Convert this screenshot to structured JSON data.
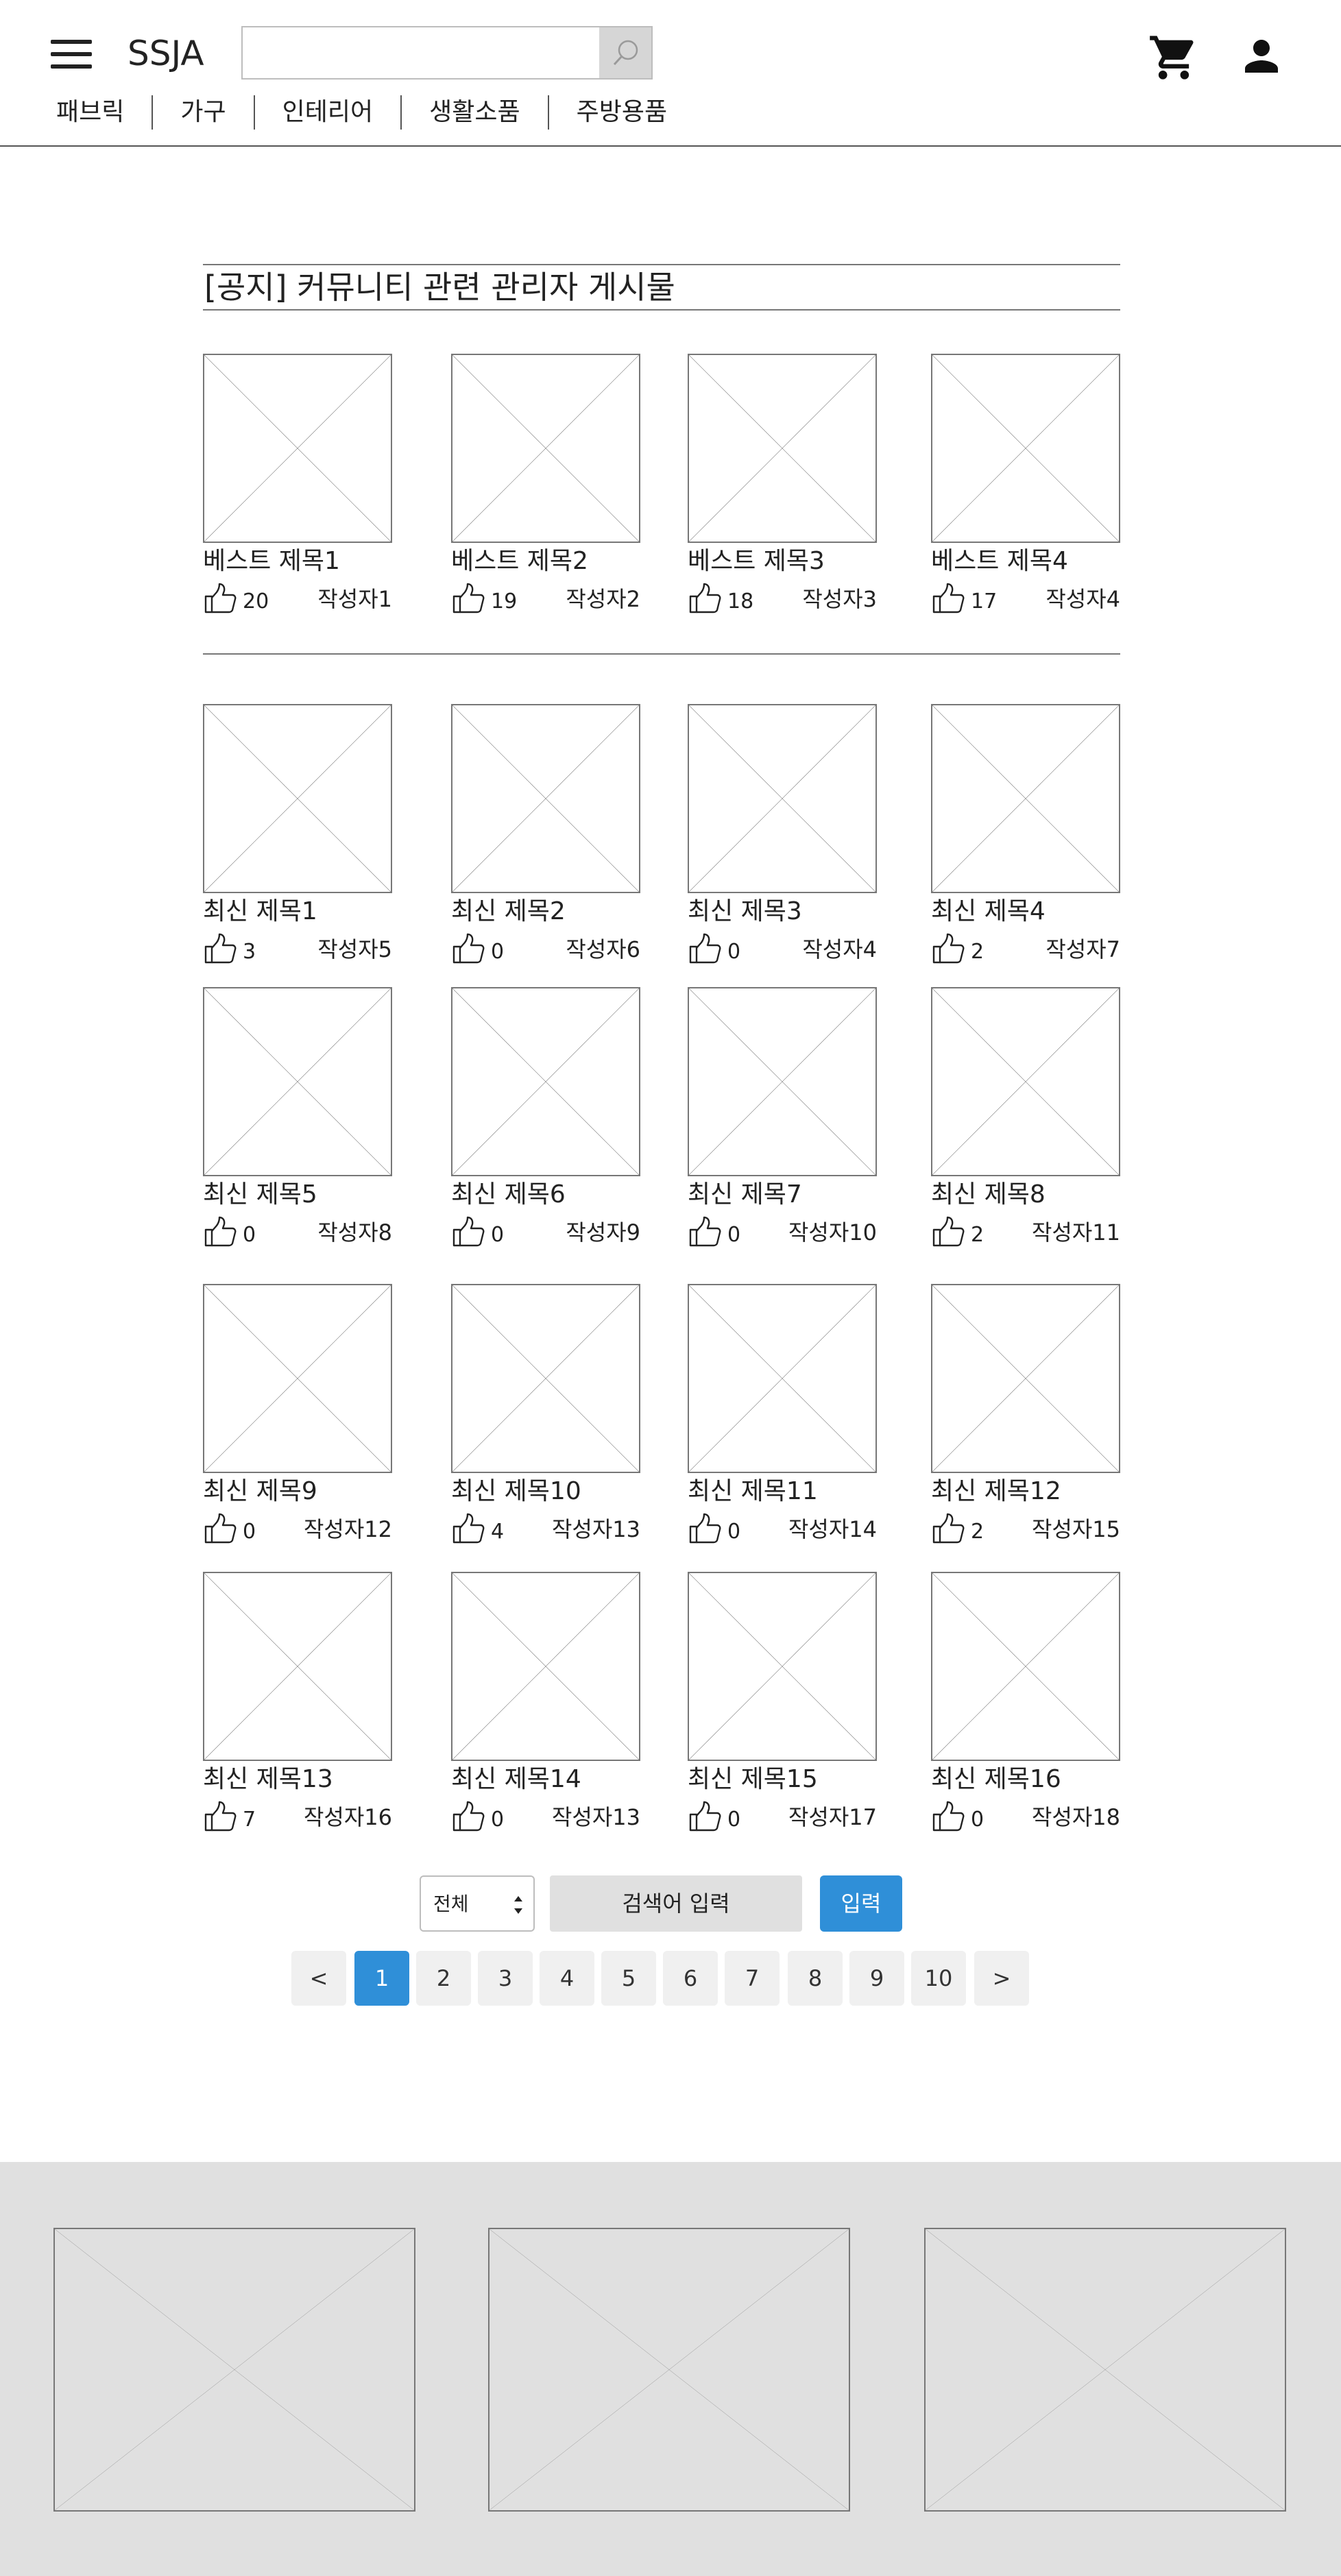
{
  "header": {
    "logo": "SSJA",
    "search": {
      "value": "",
      "placeholder": ""
    },
    "categories": [
      "패브릭",
      "가구",
      "인테리어",
      "생활소품",
      "주방용품"
    ]
  },
  "notice": {
    "title": "[공지] 커뮤니티 관련 관리자 게시물"
  },
  "best_posts": [
    {
      "title": "베스트 제목1",
      "likes": "20",
      "author": "작성자1"
    },
    {
      "title": "베스트 제목2",
      "likes": "19",
      "author": "작성자2"
    },
    {
      "title": "베스트 제목3",
      "likes": "18",
      "author": "작성자3"
    },
    {
      "title": "베스트 제목4",
      "likes": "17",
      "author": "작성자4"
    }
  ],
  "recent_posts": [
    {
      "title": "최신 제목1",
      "likes": "3",
      "author": "작성자5"
    },
    {
      "title": "최신 제목2",
      "likes": "0",
      "author": "작성자6"
    },
    {
      "title": "최신 제목3",
      "likes": "0",
      "author": "작성자4"
    },
    {
      "title": "최신 제목4",
      "likes": "2",
      "author": "작성자7"
    },
    {
      "title": "최신 제목5",
      "likes": "0",
      "author": "작성자8"
    },
    {
      "title": "최신 제목6",
      "likes": "0",
      "author": "작성자9"
    },
    {
      "title": "최신 제목7",
      "likes": "0",
      "author": "작성자10"
    },
    {
      "title": "최신 제목8",
      "likes": "2",
      "author": "작성자11"
    },
    {
      "title": "최신 제목9",
      "likes": "0",
      "author": "작성자12"
    },
    {
      "title": "최신 제목10",
      "likes": "4",
      "author": "작성자13"
    },
    {
      "title": "최신 제목11",
      "likes": "0",
      "author": "작성자14"
    },
    {
      "title": "최신 제목12",
      "likes": "2",
      "author": "작성자15"
    },
    {
      "title": "최신 제목13",
      "likes": "7",
      "author": "작성자16"
    },
    {
      "title": "최신 제목14",
      "likes": "0",
      "author": "작성자13"
    },
    {
      "title": "최신 제목15",
      "likes": "0",
      "author": "작성자17"
    },
    {
      "title": "최신 제목16",
      "likes": "0",
      "author": "작성자18"
    }
  ],
  "board_search": {
    "scope": "전체",
    "placeholder": "검색어 입력",
    "submit": "입력"
  },
  "pagination": {
    "prev": "<",
    "next": ">",
    "pages": [
      "1",
      "2",
      "3",
      "4",
      "5",
      "6",
      "7",
      "8",
      "9",
      "10"
    ],
    "current": "1"
  },
  "icons": {
    "menu": "hamburger-menu-icon",
    "search": "search-icon",
    "cart": "cart-icon",
    "user": "user-icon",
    "like": "thumbs-up-icon",
    "placeholder": "image-placeholder-icon"
  },
  "colors": {
    "accent": "#2f8fd8",
    "footer_bg": "#e0e0e0"
  }
}
